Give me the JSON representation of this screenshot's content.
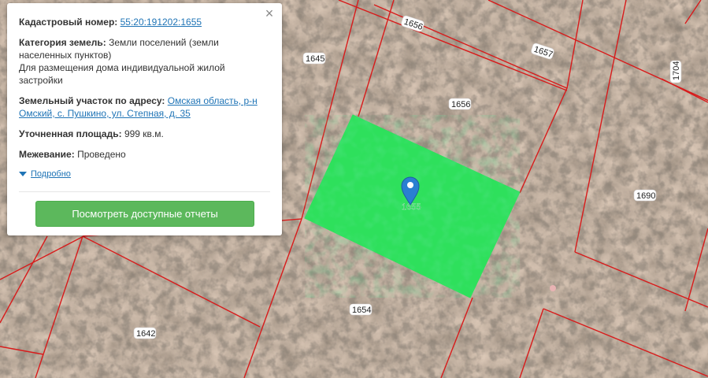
{
  "parcels": {
    "selected": "1655",
    "labels": [
      "1656",
      "1657",
      "1645",
      "1656",
      "1704",
      "1690",
      "1654",
      "1642"
    ]
  },
  "colors": {
    "selected_fill": "#2ee05c",
    "boundary": "#d81b1b",
    "marker": "#2a7fd1"
  },
  "popup": {
    "cadastral_label": "Кадастровый номер:",
    "cadastral_value": "55:20:191202:1655",
    "category_label": "Категория земель:",
    "category_value_1": "Земли поселений (земли населенных пунктов)",
    "category_value_2": "Для размещения дома индивидуальной жилой застройки",
    "address_label": "Земельный участок по адресу:",
    "address_value": "Омская область, р-н Омский, с. Пушкино, ул. Степная, д. 35",
    "area_label": "Уточненная площадь:",
    "area_value": "999 кв.м.",
    "survey_label": "Межевание:",
    "survey_value": "Проведено",
    "more_link": "Подробно",
    "reports_button": "Посмотреть доступные отчеты",
    "close_icon": "close-icon"
  }
}
